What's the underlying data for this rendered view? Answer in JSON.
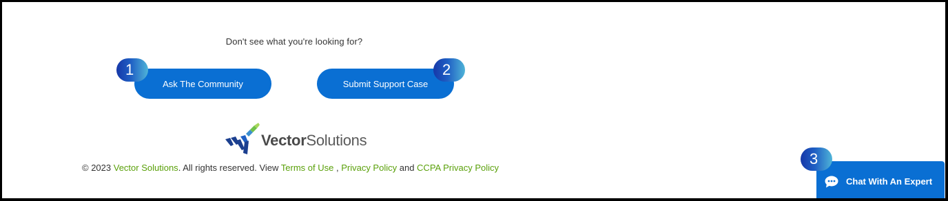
{
  "help": {
    "prompt": "Don't see what you're looking for?",
    "ask_community_label": "Ask The Community",
    "submit_case_label": "Submit Support Case"
  },
  "steps": [
    "1",
    "2",
    "3"
  ],
  "logo": {
    "word_bold": "Vector",
    "word_light": "Solutions"
  },
  "footer": {
    "copyright_prefix": "© 2023 ",
    "company_link": "Vector Solutions",
    "rights_text": ". All rights reserved. View ",
    "terms_link": "Terms of Use",
    "separator": " , ",
    "privacy_link": "Privacy Policy",
    "and_text": " and ",
    "ccpa_link": "CCPA Privacy Policy"
  },
  "chat": {
    "label": "Chat With An Expert",
    "icon": "chat-bubble-icon"
  },
  "colors": {
    "primary_blue": "#0a6fd3",
    "link_green": "#5aa00a",
    "badge_dark": "#1638a8",
    "badge_light": "#4fb4d8"
  }
}
